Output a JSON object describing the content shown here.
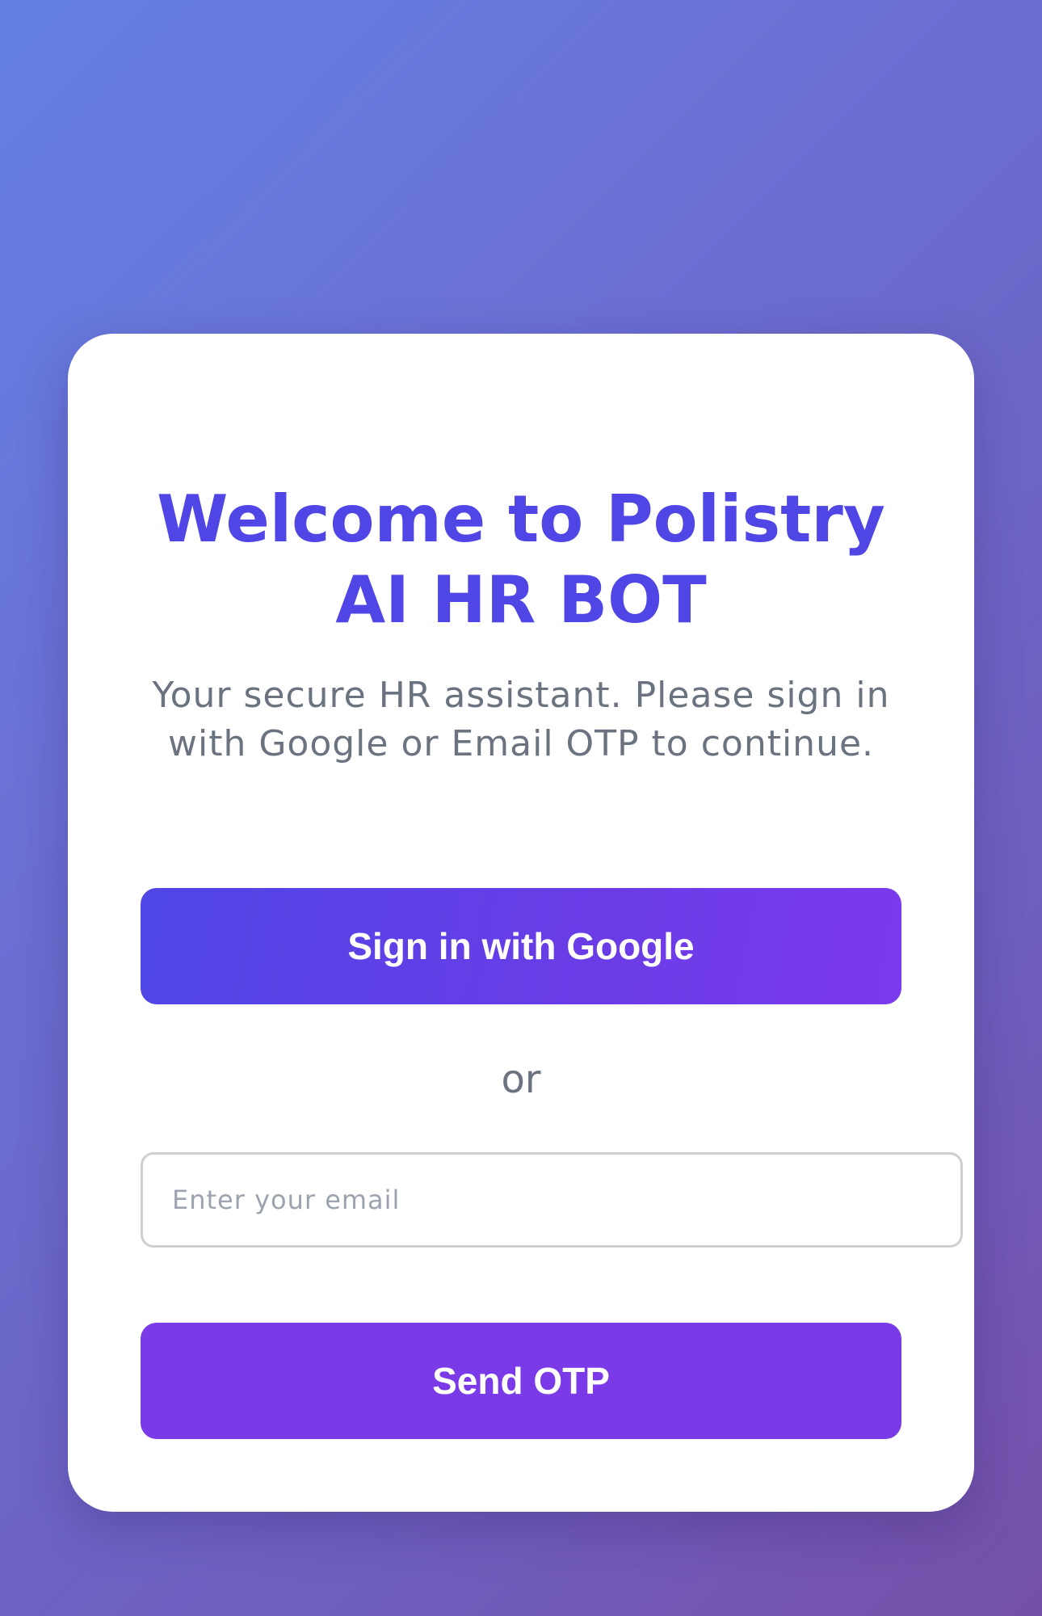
{
  "login": {
    "title_line1": "Welcome to Polistry",
    "title_line2": "AI HR BOT",
    "subtitle": "Your secure HR assistant. Please sign in with Google or Email OTP to continue.",
    "google_button_label": "Sign in with Google",
    "divider_text": "or",
    "email_placeholder": "Enter your email",
    "email_value": "",
    "otp_button_label": "Send OTP"
  },
  "colors": {
    "accent": "#4f46e5",
    "accent_purple": "#7c3aed",
    "text_muted": "#6b7280",
    "card_background": "#ffffff"
  }
}
